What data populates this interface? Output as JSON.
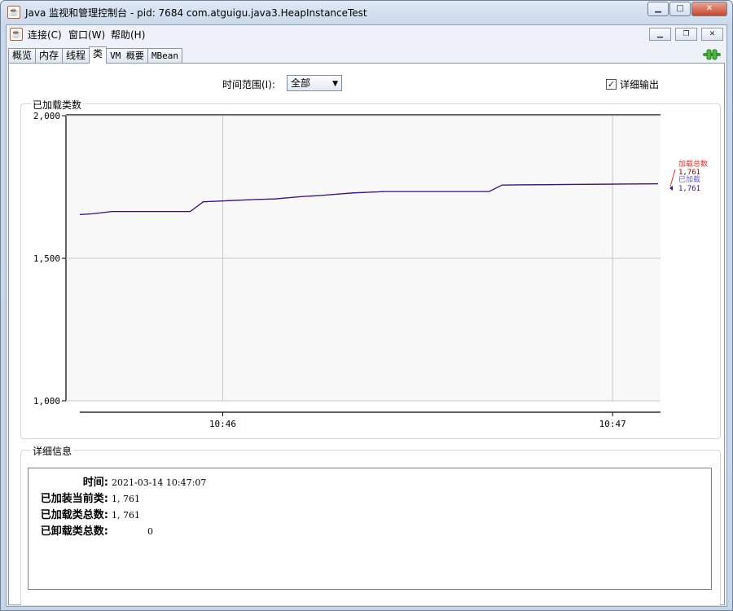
{
  "window": {
    "title": "Java 监视和管理控制台 - pid: 7684 com.atguigu.java3.HeapInstanceTest",
    "app_icon": "java-icon",
    "buttons": {
      "minimize": "▁",
      "maximize": "□",
      "close": "✕"
    }
  },
  "menubar": {
    "items": [
      "连接(C)",
      "窗口(W)",
      "帮助(H)"
    ],
    "mdi_buttons": {
      "minimize": "▁",
      "restore": "❐",
      "close": "✕"
    }
  },
  "tabs": [
    {
      "label": "概览",
      "active": false
    },
    {
      "label": "内存",
      "active": false
    },
    {
      "label": "线程",
      "active": false
    },
    {
      "label": "类",
      "active": true
    },
    {
      "label": "VM 概要",
      "active": false
    },
    {
      "label": "MBean",
      "active": false
    }
  ],
  "toolbar": {
    "range_label": "时间范围(I):",
    "range_value": "全部",
    "verbose_label": "详细输出",
    "verbose_checked": true
  },
  "colors": {
    "total_loaded": "#e03030",
    "loaded": "#3a0f8a"
  },
  "chart_data": {
    "type": "line",
    "title": "已加载类数",
    "y_ticks": [
      "2,000",
      "1,500",
      "1,000"
    ],
    "x_ticks": [
      "10:46",
      "10:47"
    ],
    "ylim": [
      1000,
      2000
    ],
    "grid": true,
    "x_axis": {
      "start": "10:45:38",
      "end": "10:47:07",
      "tick_seconds": [
        "10:46:00",
        "10:47:00"
      ]
    },
    "series": [
      {
        "name": "加载总数",
        "points": [
          [
            "10:45:38",
            1653
          ],
          [
            "10:45:40",
            1656
          ],
          [
            "10:45:43",
            1664
          ],
          [
            "10:45:47",
            1664
          ],
          [
            "10:45:51",
            1664
          ],
          [
            "10:45:53",
            1664
          ],
          [
            "10:45:55",
            1664
          ],
          [
            "10:45:57",
            1698
          ],
          [
            "10:46:01",
            1702
          ],
          [
            "10:46:05",
            1706
          ],
          [
            "10:46:08",
            1708
          ],
          [
            "10:46:12",
            1716
          ],
          [
            "10:46:15",
            1720
          ],
          [
            "10:46:20",
            1729
          ],
          [
            "10:46:25",
            1734
          ],
          [
            "10:46:41",
            1734
          ],
          [
            "10:46:43",
            1757
          ],
          [
            "10:47:07",
            1761
          ]
        ],
        "current": "1,761"
      },
      {
        "name": "已加载",
        "points": [
          [
            "10:45:38",
            1653
          ],
          [
            "10:45:40",
            1656
          ],
          [
            "10:45:43",
            1664
          ],
          [
            "10:45:47",
            1664
          ],
          [
            "10:45:51",
            1664
          ],
          [
            "10:45:53",
            1664
          ],
          [
            "10:45:55",
            1664
          ],
          [
            "10:45:57",
            1698
          ],
          [
            "10:46:01",
            1702
          ],
          [
            "10:46:05",
            1706
          ],
          [
            "10:46:08",
            1708
          ],
          [
            "10:46:12",
            1716
          ],
          [
            "10:46:15",
            1720
          ],
          [
            "10:46:20",
            1729
          ],
          [
            "10:46:25",
            1734
          ],
          [
            "10:46:41",
            1734
          ],
          [
            "10:46:43",
            1757
          ],
          [
            "10:47:07",
            1761
          ]
        ],
        "current": "1,761"
      }
    ]
  },
  "details": {
    "title": "详细信息",
    "rows": [
      {
        "label": "时间:",
        "value": "2021-03-14 10:47:07"
      },
      {
        "label": "已加装当前类:",
        "value": "1, 761"
      },
      {
        "label": "已加载类总数:",
        "value": "1, 761"
      },
      {
        "label": "已卸载类总数:",
        "value": "0"
      }
    ]
  }
}
